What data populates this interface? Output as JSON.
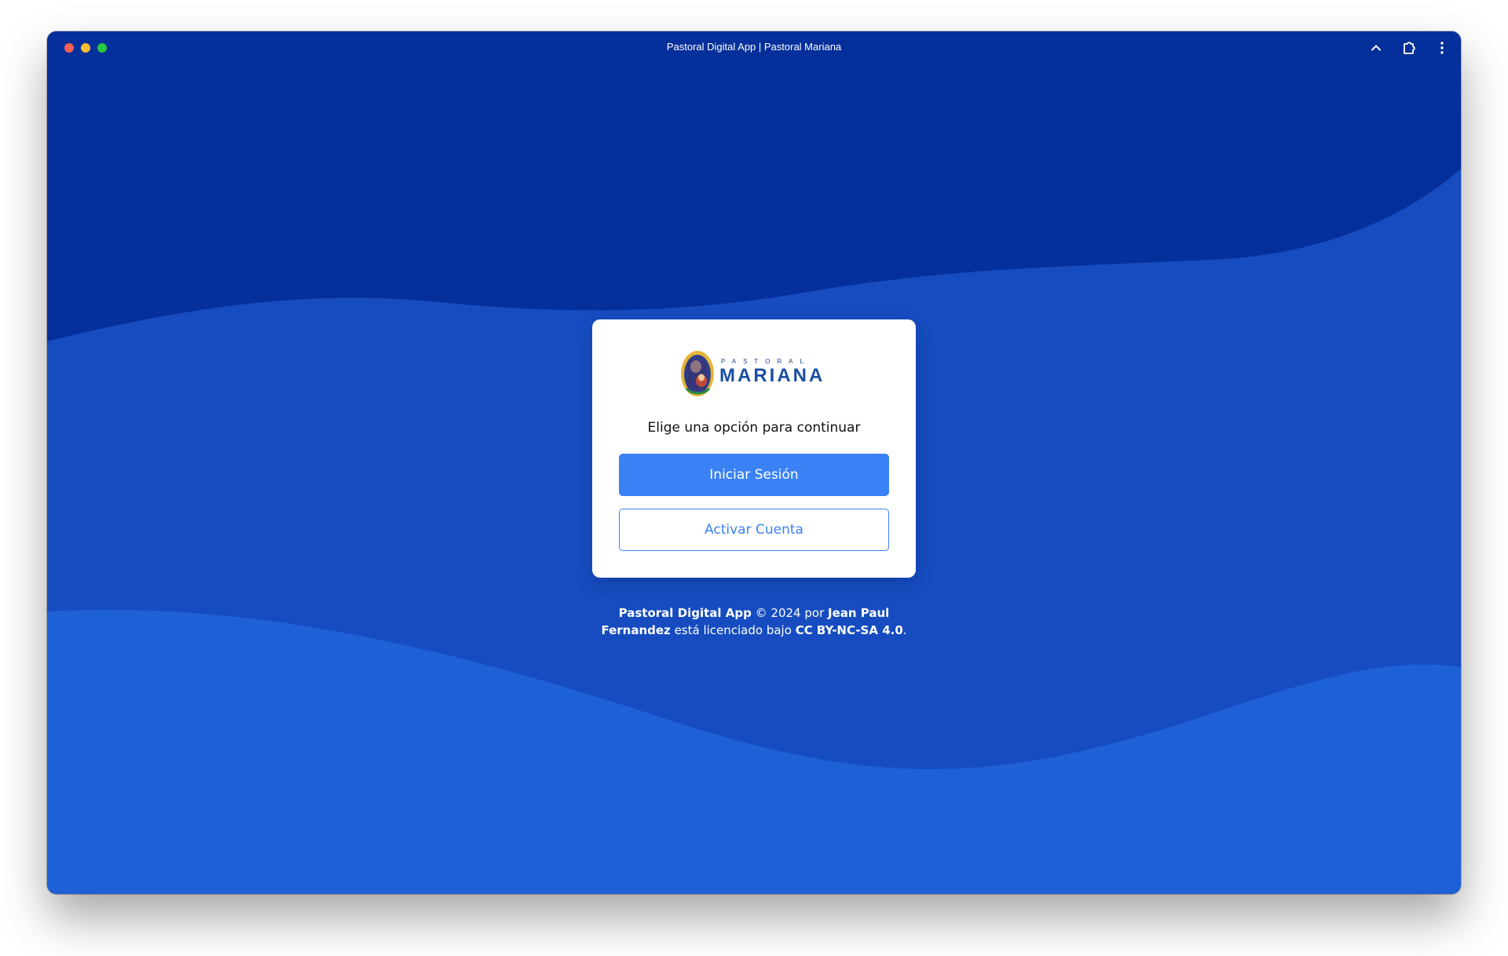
{
  "window": {
    "title": "Pastoral Digital App | Pastoral Mariana"
  },
  "titlebar_icons": [
    "chevron-up-icon",
    "extension-icon",
    "more-vertical-icon"
  ],
  "colors": {
    "wave_top": "#052f9a",
    "wave_mid": "#164cc0",
    "wave_bottom": "#1e60d6",
    "primary_button": "#3b82f6"
  },
  "card": {
    "logo": {
      "small_text": "PASTORAL",
      "big_text": "MARIANA"
    },
    "prompt": "Elige una opción para continuar",
    "login_button": "Iniciar Sesión",
    "activate_button": "Activar Cuenta"
  },
  "footer": {
    "app_name": "Pastoral Digital App",
    "copyright": "© 2024 por",
    "author_first": "Jean Paul",
    "author_last": "Fernandez",
    "license_text": "está licenciado bajo",
    "license": "CC BY-NC-SA 4.0",
    "period": "."
  }
}
